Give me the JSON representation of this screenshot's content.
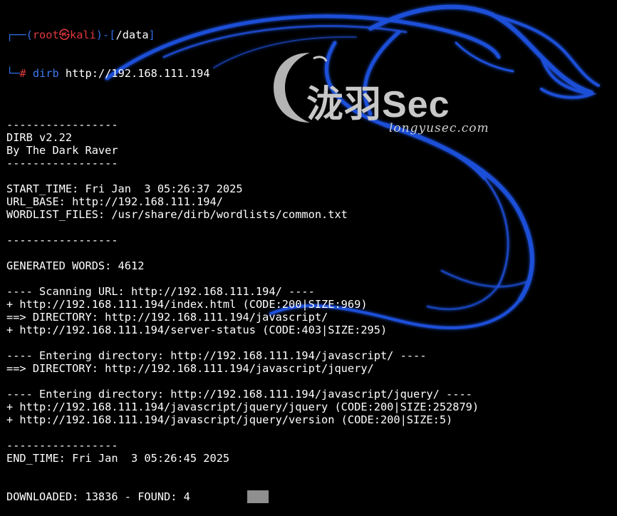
{
  "colors": {
    "background": "#000000",
    "text": "#ffffff",
    "prompt_blue": "#2f6fe6",
    "prompt_red": "#e0383f",
    "dragon_blue": "#1d4fd8"
  },
  "prompt": {
    "open": "┌──(",
    "user": "root",
    "skull": "㉿",
    "host": "kali",
    "mid": ")-[",
    "path": "/data",
    "close": "]",
    "second_prefix": "└─",
    "hash": "#",
    "command": "dirb",
    "args": "http://192.168.111.194"
  },
  "output_lines": [
    "",
    "-----------------",
    "DIRB v2.22",
    "By The Dark Raver",
    "-----------------",
    "",
    "START_TIME: Fri Jan  3 05:26:37 2025",
    "URL_BASE: http://192.168.111.194/",
    "WORDLIST_FILES: /usr/share/dirb/wordlists/common.txt",
    "",
    "-----------------",
    "",
    "GENERATED WORDS: 4612",
    "",
    "---- Scanning URL: http://192.168.111.194/ ----",
    "+ http://192.168.111.194/index.html (CODE:200|SIZE:969)",
    "==> DIRECTORY: http://192.168.111.194/javascript/",
    "+ http://192.168.111.194/server-status (CODE:403|SIZE:295)",
    "",
    "---- Entering directory: http://192.168.111.194/javascript/ ----",
    "==> DIRECTORY: http://192.168.111.194/javascript/jquery/",
    "",
    "---- Entering directory: http://192.168.111.194/javascript/jquery/ ----",
    "+ http://192.168.111.194/javascript/jquery/jquery (CODE:200|SIZE:252879)",
    "+ http://192.168.111.194/javascript/jquery/version (CODE:200|SIZE:5)",
    "",
    "-----------------",
    "END_TIME: Fri Jan  3 05:26:45 2025"
  ],
  "last_line": "DOWNLOADED: 13836 - FOUND: 4",
  "watermark": {
    "brand": "泷羽Sec",
    "url": "longyusec.com",
    "logo_icon": "crescent-logo-icon"
  },
  "background_icon": "kali-dragon-icon"
}
